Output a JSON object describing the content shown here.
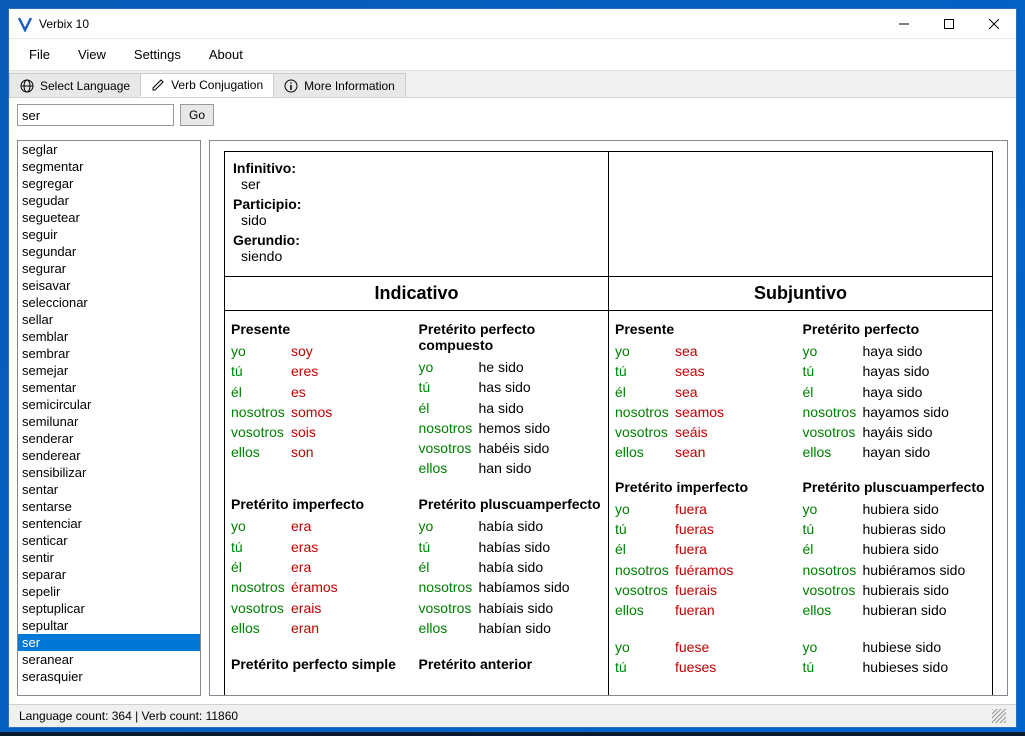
{
  "window": {
    "title": "Verbix 10"
  },
  "menu": [
    "File",
    "View",
    "Settings",
    "About"
  ],
  "tabs": [
    {
      "label": "Select Language",
      "icon": "globe-icon"
    },
    {
      "label": "Verb Conjugation",
      "icon": "pencil-icon",
      "active": true
    },
    {
      "label": "More Information",
      "icon": "info-icon"
    }
  ],
  "input": {
    "value": "ser",
    "go_label": "Go"
  },
  "sidebar": {
    "items": [
      "seglar",
      "segmentar",
      "segregar",
      "segudar",
      "seguetear",
      "seguir",
      "segundar",
      "segurar",
      "seisavar",
      "seleccionar",
      "sellar",
      "semblar",
      "sembrar",
      "semejar",
      "sementar",
      "semicircular",
      "semilunar",
      "senderar",
      "senderear",
      "sensibilizar",
      "sentar",
      "sentarse",
      "sentenciar",
      "senticar",
      "sentir",
      "separar",
      "sepelir",
      "septuplicar",
      "sepultar",
      "ser",
      "seranear",
      "serasquier"
    ],
    "selected": "ser"
  },
  "nominal": {
    "infinitivo_label": "Infinitivo:",
    "infinitivo": "ser",
    "participio_label": "Participio:",
    "participio": "sido",
    "gerundio_label": "Gerundio:",
    "gerundio": "siendo"
  },
  "moods": {
    "indicativo": "Indicativo",
    "subjuntivo": "Subjuntivo"
  },
  "pronouns": [
    "yo",
    "tú",
    "él",
    "nosotros",
    "vosotros",
    "ellos"
  ],
  "indicativo": {
    "presente": {
      "title": "Presente",
      "irregular": true,
      "forms": [
        "soy",
        "eres",
        "es",
        "somos",
        "sois",
        "son"
      ]
    },
    "pret_perf_comp": {
      "title": "Pretérito perfecto compuesto",
      "irregular": false,
      "forms": [
        "he sido",
        "has sido",
        "ha sido",
        "hemos sido",
        "habéis sido",
        "han sido"
      ]
    },
    "pret_imperf": {
      "title": "Pretérito imperfecto",
      "irregular": true,
      "forms": [
        "era",
        "eras",
        "era",
        "éramos",
        "erais",
        "eran"
      ]
    },
    "pret_plus": {
      "title": "Pretérito pluscuamperfecto",
      "irregular": false,
      "forms": [
        "había sido",
        "habías sido",
        "había sido",
        "habíamos sido",
        "habíais sido",
        "habían sido"
      ]
    },
    "pret_perf_simple": {
      "title": "Pretérito perfecto simple"
    },
    "pret_anterior": {
      "title": "Pretérito anterior"
    }
  },
  "subjuntivo": {
    "presente": {
      "title": "Presente",
      "irregular": true,
      "forms": [
        "sea",
        "seas",
        "sea",
        "seamos",
        "seáis",
        "sean"
      ]
    },
    "pret_perf": {
      "title": "Pretérito perfecto",
      "irregular": false,
      "forms": [
        "haya sido",
        "hayas sido",
        "haya sido",
        "hayamos sido",
        "hayáis sido",
        "hayan sido"
      ]
    },
    "pret_imperf": {
      "title": "Pretérito imperfecto",
      "irregular": true,
      "forms": [
        "fuera",
        "fueras",
        "fuera",
        "fuéramos",
        "fuerais",
        "fueran"
      ]
    },
    "pret_plus": {
      "title": "Pretérito pluscuamperfecto",
      "irregular": false,
      "forms": [
        "hubiera sido",
        "hubieras sido",
        "hubiera sido",
        "hubiéramos sido",
        "hubierais sido",
        "hubieran sido"
      ]
    },
    "pret_imperf2": {
      "irregular": true,
      "forms_partial": [
        "fuese",
        "fueses"
      ]
    },
    "pret_plus2": {
      "irregular": false,
      "forms_partial": [
        "hubiese sido",
        "hubieses sido"
      ]
    }
  },
  "statusbar": {
    "text": "Language count: 364  |  Verb count: 11860"
  }
}
